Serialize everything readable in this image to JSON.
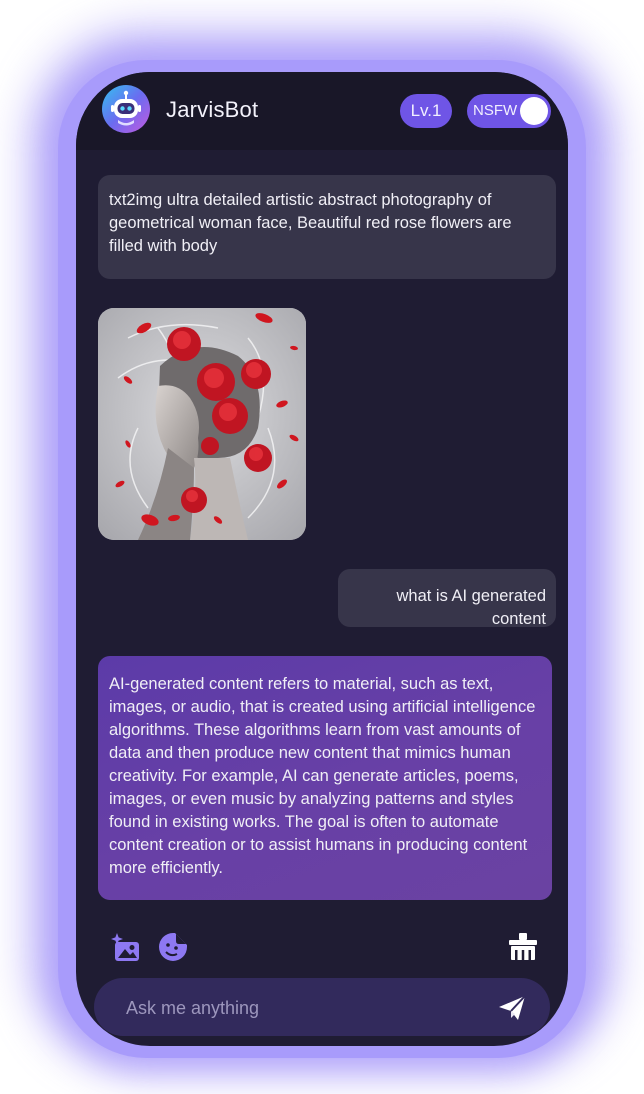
{
  "header": {
    "bot_name": "JarvisBot",
    "level_badge": "Lv.1",
    "nsfw_label": "NSFW",
    "nsfw_enabled": true
  },
  "messages": [
    {
      "role": "user",
      "text": "txt2img ultra detailed artistic abstract photography of geometrical woman face, Beautiful red rose flowers are filled with body"
    },
    {
      "role": "bot",
      "type": "image",
      "icon": "generated-image-woman-roses"
    },
    {
      "role": "user",
      "text": "what is AI generated content"
    },
    {
      "role": "bot",
      "text": "AI-generated content refers to material, such as text, images, or audio, that is created using artificial intelligence algorithms. These algorithms learn from vast amounts of data and then produce new content that mimics human creativity. For example, AI can generate articles, poems, images, or even music by analyzing patterns and styles found in existing works. The goal is often to automate content creation or to assist humans in producing content more efficiently."
    }
  ],
  "toolbar": {
    "icons": [
      "image-generate-icon",
      "sticker-icon",
      "clear-chat-broom-icon"
    ]
  },
  "input": {
    "placeholder": "Ask me anything",
    "value": ""
  },
  "colors": {
    "frame": "#a89bfb",
    "screen_bg": "#1f1c33",
    "accent": "#6f55e6",
    "user_bubble": "#37354a",
    "bot_bubble": "#5c3ba8",
    "input_bg": "#322a5c"
  }
}
